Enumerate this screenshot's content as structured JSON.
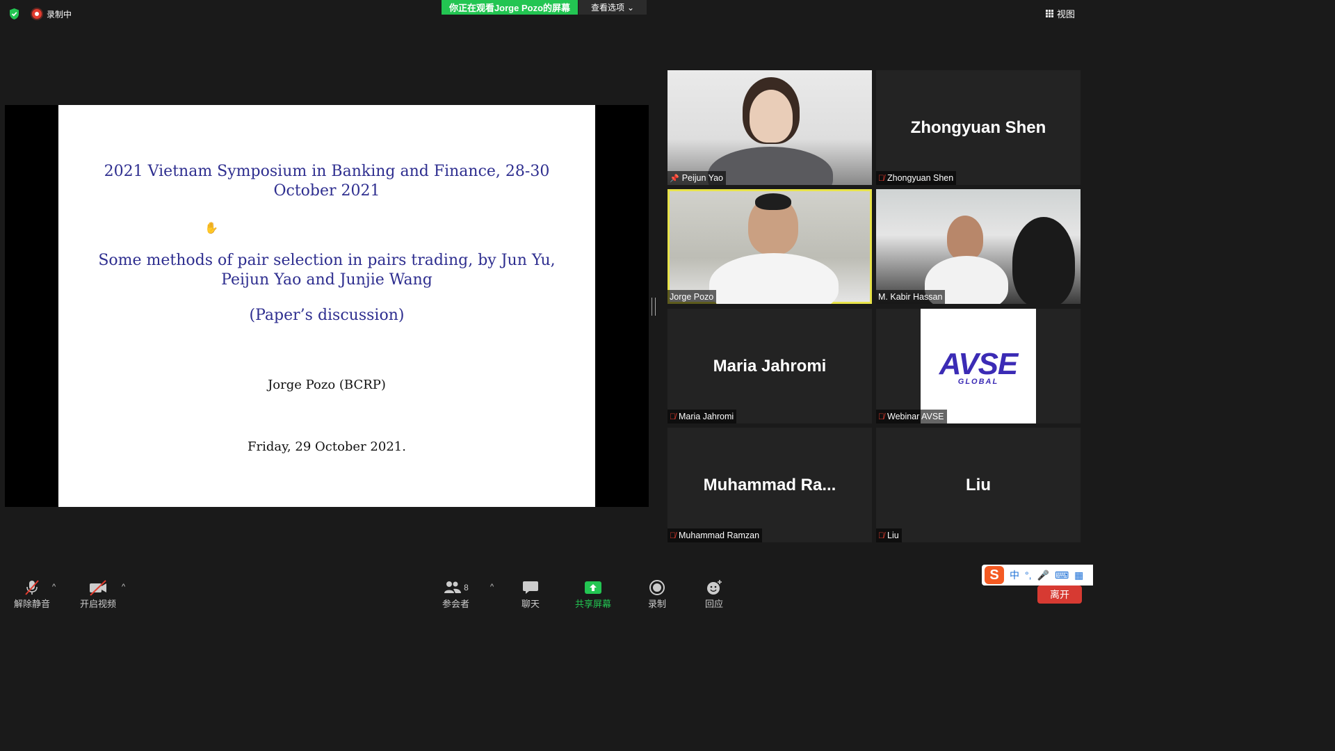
{
  "top_bar": {
    "recording_label": "录制中",
    "viewing_banner": "你正在观看Jorge Pozo的屏幕",
    "view_options_label": "查看选项",
    "view_button_label": "视图"
  },
  "slide": {
    "title": "2021 Vietnam Symposium in Banking and Finance, 28-30 October 2021",
    "paper": "Some methods of pair selection in pairs trading, by Jun Yu, Peijun Yao and Junjie Wang",
    "subtitle": "(Paper’s discussion)",
    "author": "Jorge Pozo (BCRP)",
    "date": "Friday, 29 October 2021."
  },
  "participants": [
    {
      "label": "Peijun Yao",
      "display_name": "",
      "icon": "pin-icon"
    },
    {
      "label": "Zhongyuan Shen",
      "display_name": "Zhongyuan Shen",
      "icon": "mic-off-icon"
    },
    {
      "label": "Jorge Pozo",
      "display_name": "",
      "icon": ""
    },
    {
      "label": "M. Kabir Hassan",
      "display_name": "",
      "icon": ""
    },
    {
      "label": "Maria Jahromi",
      "display_name": "Maria Jahromi",
      "icon": "mic-off-icon"
    },
    {
      "label": "Webinar AVSE",
      "display_name": "",
      "icon": "mic-off-icon",
      "logo_text": "AVSE",
      "logo_sub": "GLOBAL"
    },
    {
      "label": "Muhammad Ramzan",
      "display_name": "Muhammad  Ra...",
      "icon": "mic-off-icon"
    },
    {
      "label": "Liu",
      "display_name": "Liu",
      "icon": "mic-off-icon"
    }
  ],
  "toolbar": {
    "unmute": "解除静音",
    "start_video": "开启视频",
    "participants": "参会者",
    "participants_count": "8",
    "chat": "聊天",
    "share_screen": "共享屏幕",
    "record": "录制",
    "reactions": "回应",
    "leave": "离开"
  },
  "ime": {
    "mode": "中"
  },
  "colors": {
    "banner_green": "#23c552",
    "active_speaker": "#e8e34a",
    "leave_red": "#d73a32",
    "slide_text": "#2e2e8f"
  }
}
